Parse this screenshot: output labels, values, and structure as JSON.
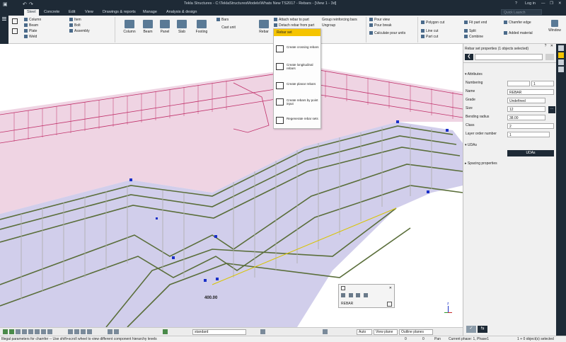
{
  "window": {
    "title": "Tekla Structures - C:\\TeklaStructuresModels\\Whats New TS2017 - Rebars - [View 1 - 3d]",
    "help": "?",
    "login": "Log in",
    "minimize": "—",
    "maximize": "❐",
    "close": "✕"
  },
  "tabs": [
    {
      "label": "Steel"
    },
    {
      "label": "Concrete"
    },
    {
      "label": "Edit"
    },
    {
      "label": "View"
    },
    {
      "label": "Drawings & reports"
    },
    {
      "label": "Manage"
    },
    {
      "label": "Analysis & design"
    }
  ],
  "quick_launch": {
    "placeholder": "Quick Launch"
  },
  "ribbon": {
    "steel_small": [
      "Column",
      "Beam",
      "Plate",
      "Weld"
    ],
    "steel_small2": [
      "Item",
      "Bolt",
      "Assembly"
    ],
    "concrete_big": [
      "Column",
      "Beam",
      "Panel",
      "Slab",
      "Footing",
      "Cast unit",
      "Rebar"
    ],
    "bars": "Bars",
    "rebar_items": [
      "Attach rebar to part",
      "Detach rebar from part",
      "Rebar set"
    ],
    "group_items": [
      "Group reinforcing bars",
      "Ungroup"
    ],
    "pour_items": [
      "Pour view",
      "Pour break",
      "Calculate pour units"
    ],
    "cut_items": [
      "Polygon cut",
      "Line cut",
      "Part cut"
    ],
    "fit_items": [
      "Fit part end",
      "Split",
      "Combine"
    ],
    "chamfer_items": [
      "Chamfer edge",
      "Added material"
    ],
    "window": "Window"
  },
  "dropdown": {
    "header": "Rebar set",
    "items": [
      {
        "label": "Create crossing rebars"
      },
      {
        "label": "Create longitudinal rebars"
      },
      {
        "label": "Create planar rebars"
      },
      {
        "label": "Create rebars by point input"
      },
      {
        "label": "Regenerate rebar sets"
      }
    ]
  },
  "panel": {
    "title": "Rebar set properties (1 objects selected)",
    "attributes_header": "Attributes",
    "numbering": {
      "label": "Numbering",
      "value1": "",
      "value2": "1"
    },
    "name": {
      "label": "Name",
      "value": "REBAR"
    },
    "grade": {
      "label": "Grade",
      "value": "Undefined"
    },
    "size": {
      "label": "Size",
      "value": "12"
    },
    "bending_radius": {
      "label": "Bending radius",
      "value": "38.00"
    },
    "class": {
      "label": "Class",
      "value": "2"
    },
    "layer_order": {
      "label": "Layer order number",
      "value": "1"
    },
    "udas_header": "UDAs",
    "udas_button": "UDAs",
    "spacing_header": "Spacing properties"
  },
  "viewport": {
    "dimension_label": "400.00",
    "axis_z": "z",
    "mini_toolbar_label": "REBAR"
  },
  "bottom_toolbar": {
    "filter": "standard",
    "snap_mode": "Auto",
    "plane": "View plane",
    "outline": "Outline planes"
  },
  "status": {
    "message": "Illegal parameters for chamfer -- Use shift+scroll wheel to view different component hierarchy levels",
    "x": "0",
    "y": "0",
    "mode": "Pan",
    "phase": "Current phase: 1, Phase1",
    "selection": "1 + 0 object(s) selected"
  },
  "colors": {
    "title_bg": "#1e2a36",
    "accent": "#f5c400",
    "concrete_fill": "#c9c6e8",
    "rebar_pink": "#c0306a",
    "rebar_green": "#5a6e3a",
    "handle_blue": "#1a30c8"
  }
}
